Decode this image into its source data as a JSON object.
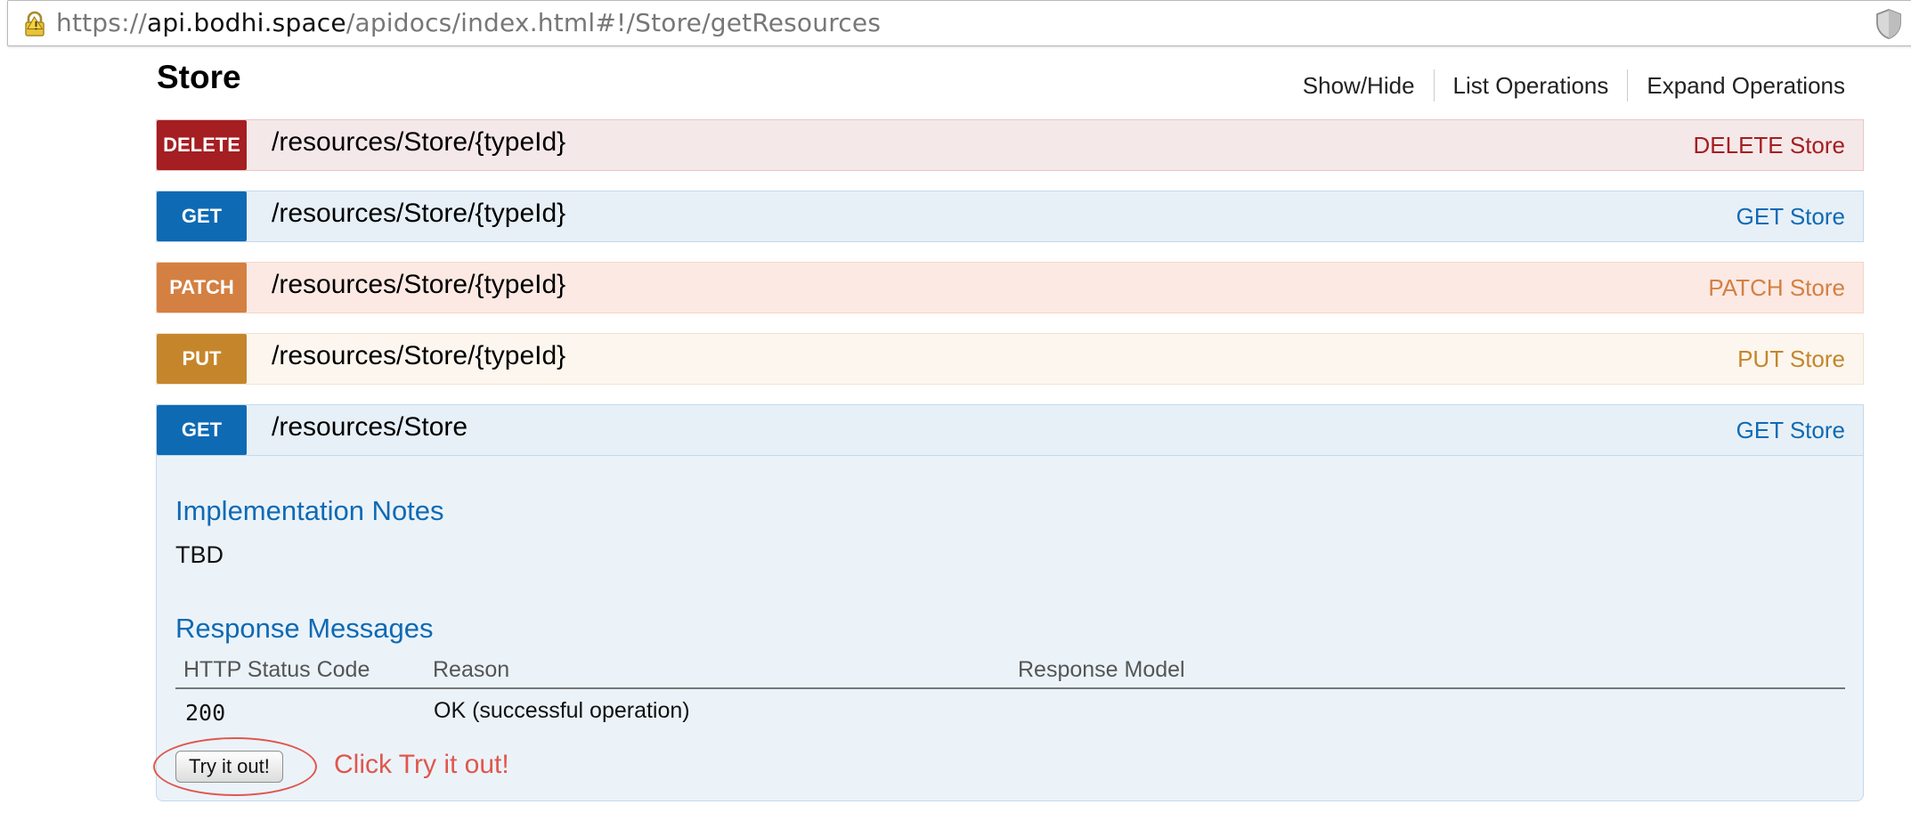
{
  "browser": {
    "url_prefix": "https://",
    "url_host": "api.bodhi.space",
    "url_path": "/apidocs/index.html#!/Store/getResources",
    "lock_icon": "warning-lock-icon",
    "shield_icon": "shield-icon"
  },
  "resource": {
    "title": "Store",
    "links": {
      "show_hide": "Show/Hide",
      "list_operations": "List Operations",
      "expand_operations": "Expand Operations"
    }
  },
  "operations": [
    {
      "method": "DELETE",
      "path": "/resources/Store/{typeId}",
      "summary": "DELETE Store",
      "color": "#a41e22"
    },
    {
      "method": "GET",
      "path": "/resources/Store/{typeId}",
      "summary": "GET Store",
      "color": "#0f6ab4"
    },
    {
      "method": "PATCH",
      "path": "/resources/Store/{typeId}",
      "summary": "PATCH Store",
      "color": "#d38042"
    },
    {
      "method": "PUT",
      "path": "/resources/Store/{typeId}",
      "summary": "PUT Store",
      "color": "#c5862b"
    },
    {
      "method": "GET",
      "path": "/resources/Store",
      "summary": "GET Store",
      "color": "#0f6ab4"
    }
  ],
  "expanded": {
    "implementation_notes_heading": "Implementation Notes",
    "implementation_notes": "TBD",
    "response_messages_heading": "Response Messages",
    "table_headers": {
      "status_code": "HTTP Status Code",
      "reason": "Reason",
      "response_model": "Response Model"
    },
    "responses": [
      {
        "code": "200",
        "reason": "OK (successful operation)",
        "model": ""
      }
    ],
    "try_button_label": "Try it out!",
    "annotation": "Click Try it out!"
  }
}
